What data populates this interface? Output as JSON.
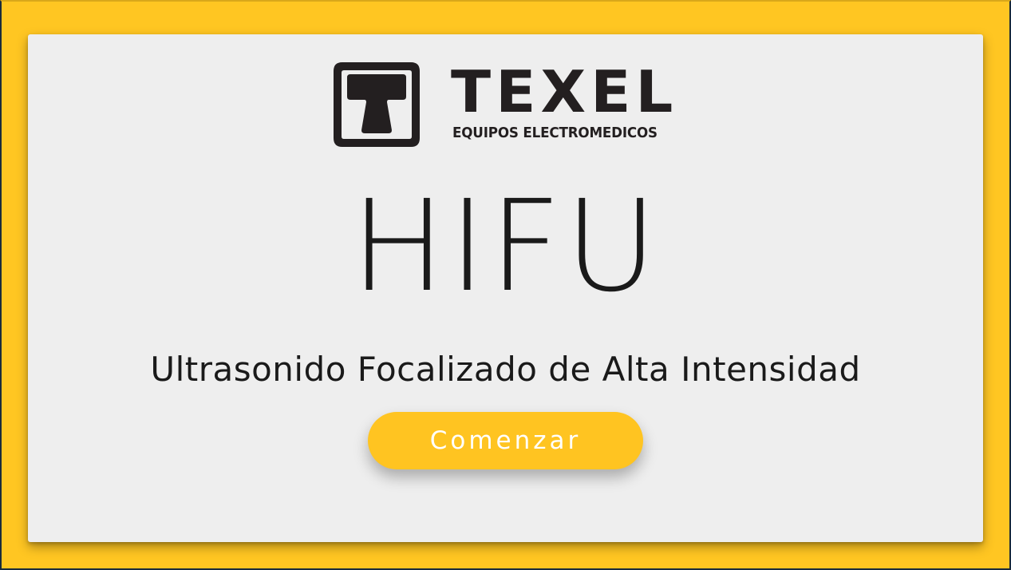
{
  "logo": {
    "brand": "TEXEL",
    "tagline": "EQUIPOS ELECTROMEDICOS",
    "mark_icon": "texel-t-logo-icon"
  },
  "hero": {
    "title": "HIFU",
    "subtitle": "Ultrasonido Focalizado de Alta Intensidad"
  },
  "actions": {
    "start_label": "Comenzar"
  },
  "colors": {
    "background": "#ffc421",
    "card": "#eeeeee",
    "text": "#1a1a1a",
    "button": "#ffc421",
    "button_text": "#ffffff"
  }
}
